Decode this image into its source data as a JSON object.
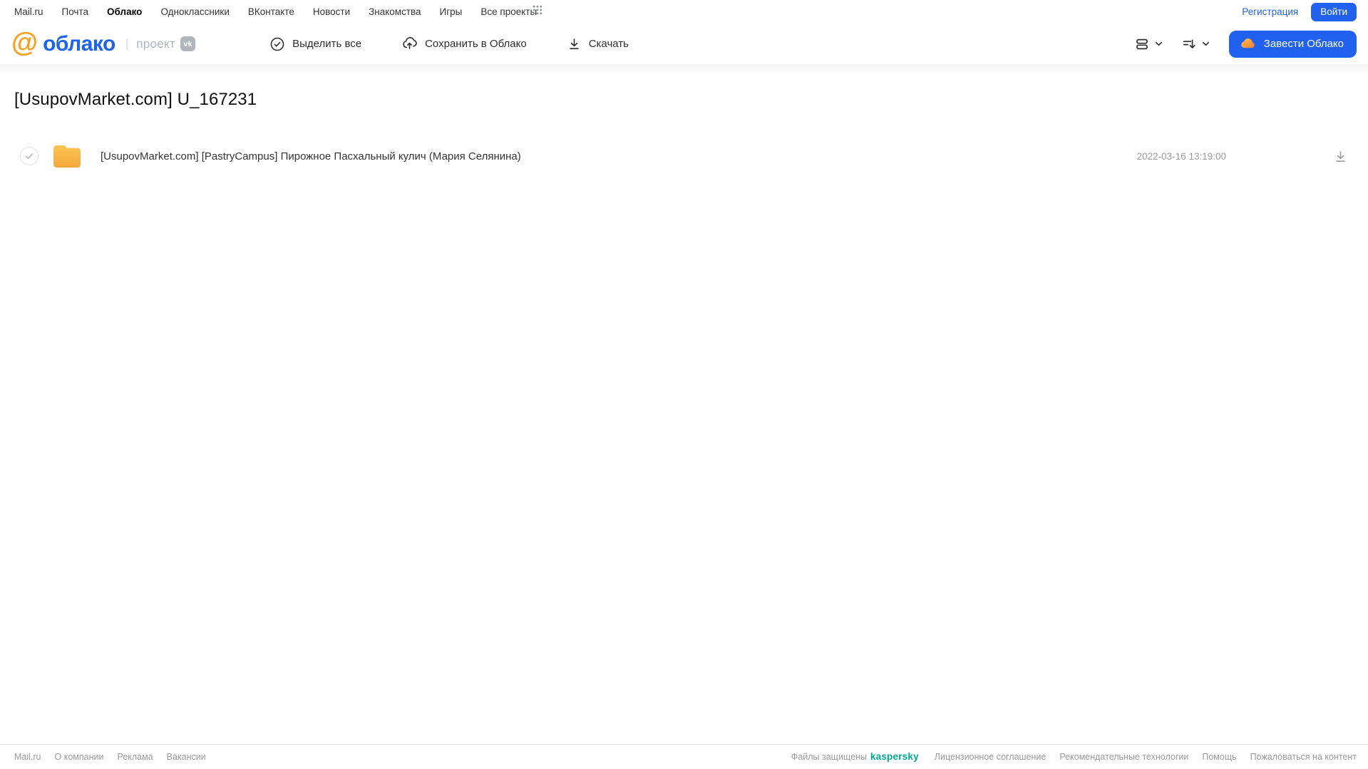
{
  "top_nav": {
    "links": [
      "Mail.ru",
      "Почта",
      "Облако",
      "Одноклассники",
      "ВКонтакте",
      "Новости",
      "Знакомства",
      "Игры",
      "Все проекты"
    ],
    "active_link": "Облако",
    "register_label": "Регистрация",
    "login_label": "Войти"
  },
  "header": {
    "logo_at": "@",
    "logo_text": "облако",
    "project_label": "проект",
    "vk_badge": "vk",
    "toolbar": {
      "select_all_label": "Выделить все",
      "save_to_cloud_label": "Сохранить в Облако",
      "download_label": "Скачать"
    },
    "get_cloud_label": "Завести Облако"
  },
  "main": {
    "title": "[UsupovMarket.com] U_167231",
    "files": [
      {
        "type": "folder",
        "name": "[UsupovMarket.com] [PastryCampus] Пирожное Пасхальный кулич (Мария Селянина)",
        "date": "2022-03-16 13:19:00"
      }
    ]
  },
  "footer": {
    "left_links": [
      "Mail.ru",
      "О компании",
      "Реклама",
      "Вакансии"
    ],
    "protected_label": "Файлы защищены",
    "kaspersky_label": "kaspersky",
    "right_links": [
      "Лицензионное соглашение",
      "Рекомендательные технологии",
      "Помощь",
      "Пожаловаться на контент"
    ]
  },
  "colors": {
    "accent_blue": "#2061f0",
    "logo_orange": "#f7a021",
    "logo_blue": "#1d63ec",
    "folder_yellow_top": "#fcc556",
    "folder_yellow_bottom": "#f5a73c",
    "kaspersky_green": "#00a88e",
    "muted_gray": "#9a9a9a"
  }
}
